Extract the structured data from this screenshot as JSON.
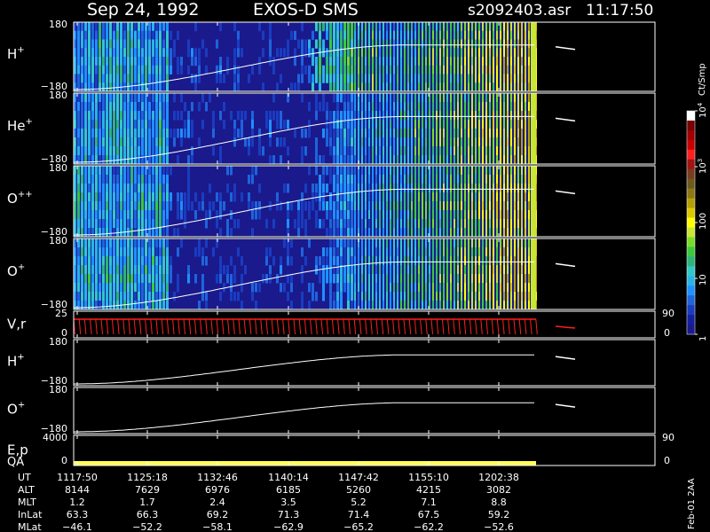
{
  "header": {
    "date": "Sep 24, 1992",
    "instrument": "EXOS-D SMS",
    "file": "s2092403.asr",
    "time": "11:17:50"
  },
  "colorbar": {
    "unit_label": "Ct/Smp",
    "ticks": [
      "1",
      "10",
      "100",
      "10",
      "10"
    ],
    "tick_exponents": [
      "",
      "",
      "",
      "3",
      "4"
    ],
    "tick_values": [
      1,
      10,
      100,
      1000,
      10000
    ],
    "colors": [
      "#1a1a8c",
      "#14209e",
      "#1a3cc0",
      "#1e64dc",
      "#1e90ff",
      "#28b4e6",
      "#32c8c8",
      "#2db478",
      "#3cc83c",
      "#78dc28",
      "#c8e632",
      "#ffff00",
      "#dcc800",
      "#b4a000",
      "#8c7814",
      "#6e5a1e",
      "#783c1e",
      "#a01414",
      "#ff1e1e",
      "#c80000",
      "#a00000",
      "#780000",
      "#ffffff"
    ]
  },
  "panels": [
    {
      "label": "H",
      "sup": "+",
      "top": "180",
      "bottom": "−180",
      "kind": "spectrogram"
    },
    {
      "label": "He",
      "sup": "+",
      "top": "180",
      "bottom": "−180",
      "kind": "spectrogram"
    },
    {
      "label": "O",
      "sup": "++",
      "top": "180",
      "bottom": "−180",
      "kind": "spectrogram"
    },
    {
      "label": "O",
      "sup": "+",
      "top": "180",
      "bottom": "−180",
      "kind": "spectrogram"
    },
    {
      "label": "V,r",
      "sup": "",
      "top": "25",
      "bottom": "0",
      "right_top": "90",
      "right_bottom": "0",
      "kind": "velocity"
    },
    {
      "label": "H",
      "sup": "+",
      "top": "180",
      "bottom": "−180",
      "kind": "line"
    },
    {
      "label": "O",
      "sup": "+",
      "top": "180",
      "bottom": "−180",
      "kind": "line"
    },
    {
      "label": "E,p",
      "label2": "QA",
      "sup": "",
      "top": "4000",
      "bottom": "0",
      "right_top": "90",
      "right_bottom": "0",
      "kind": "qa"
    }
  ],
  "footer": {
    "side_label": "Feb-01 2AA",
    "row_labels": [
      "UT",
      "ALT",
      "MLT",
      "InLat",
      "MLat"
    ],
    "columns": [
      {
        "UT": "1117:50",
        "ALT": "8144",
        "MLT": "1.2",
        "InLat": "63.3",
        "MLat": "−46.1"
      },
      {
        "UT": "1125:18",
        "ALT": "7629",
        "MLT": "1.7",
        "InLat": "66.3",
        "MLat": "−52.2"
      },
      {
        "UT": "1132:46",
        "ALT": "6976",
        "MLT": "2.4",
        "InLat": "69.2",
        "MLat": "−58.1"
      },
      {
        "UT": "1140:14",
        "ALT": "6185",
        "MLT": "3.5",
        "InLat": "71.3",
        "MLat": "−62.9"
      },
      {
        "UT": "1147:42",
        "ALT": "5260",
        "MLT": "5.2",
        "InLat": "71.4",
        "MLat": "−65.2"
      },
      {
        "UT": "1155:10",
        "ALT": "4215",
        "MLT": "7.1",
        "InLat": "67.5",
        "MLat": "−62.2"
      },
      {
        "UT": "1202:38",
        "ALT": "3082",
        "MLT": "8.8",
        "InLat": "59.2",
        "MLat": "−52.6"
      }
    ]
  },
  "chart_data": {
    "type": "heatmap",
    "title": "Sep 24, 1992   EXOS-D SMS",
    "x_ticks": [
      "1117:50",
      "1125:18",
      "1132:46",
      "1140:14",
      "1147:42",
      "1155:10",
      "1202:38"
    ],
    "y_range_pitch": [
      -180,
      180
    ],
    "colorbar_range": [
      1,
      10000
    ],
    "colorbar_scale": "log",
    "series": [
      {
        "name": "H+",
        "kind": "spectrogram"
      },
      {
        "name": "He+",
        "kind": "spectrogram"
      },
      {
        "name": "O++",
        "kind": "spectrogram"
      },
      {
        "name": "O+",
        "kind": "spectrogram"
      },
      {
        "name": "V,r",
        "kind": "line",
        "ylim": [
          0,
          25
        ],
        "y2lim": [
          0,
          90
        ]
      },
      {
        "name": "H+",
        "kind": "line",
        "ylim": [
          -180,
          180
        ]
      },
      {
        "name": "O+",
        "kind": "line",
        "ylim": [
          -180,
          180
        ]
      },
      {
        "name": "E,p / QA",
        "kind": "line",
        "ylim": [
          0,
          4000
        ],
        "y2lim": [
          0,
          90
        ]
      }
    ]
  }
}
